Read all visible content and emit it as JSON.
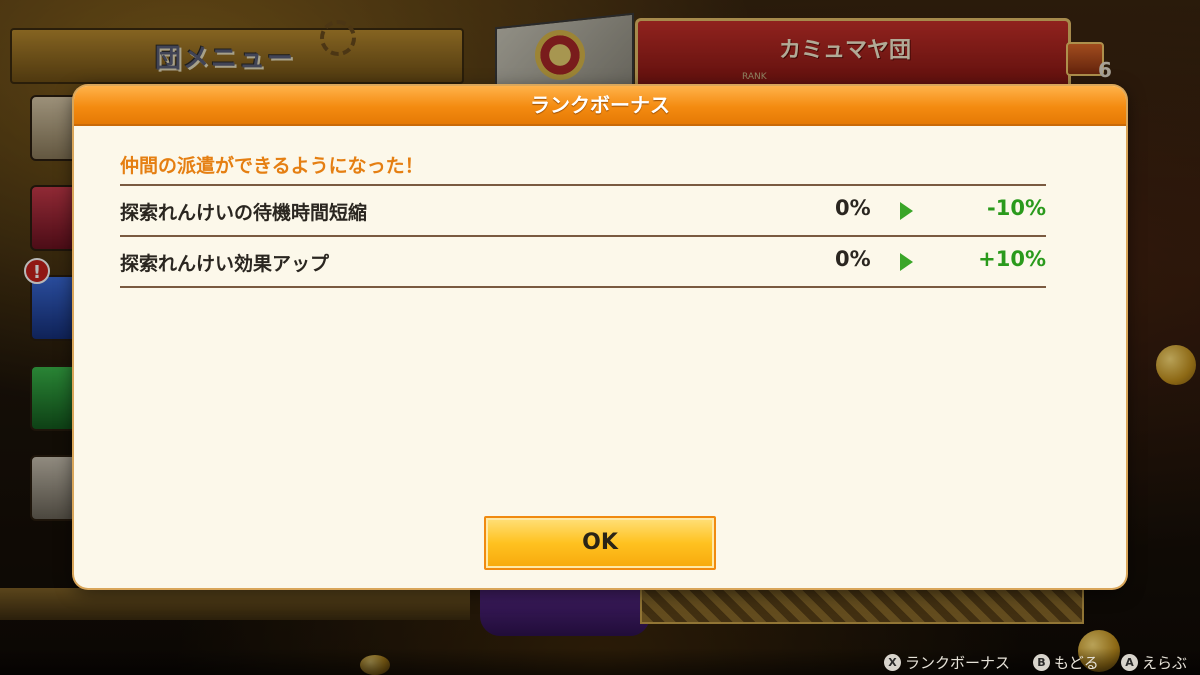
{
  "background": {
    "guild_menu_title": "団メニュー",
    "team_name": "カミュマヤ団",
    "rank_label": "RANK",
    "chest_count": "6"
  },
  "dialog": {
    "title": "ランクボーナス",
    "headline": "仲間の派遣ができるようになった！",
    "rows": [
      {
        "label": "探索れんけいの待機時間短縮",
        "before": "0%",
        "after": "-10%"
      },
      {
        "label": "探索れんけい効果アップ",
        "before": "0%",
        "after": "+10%"
      }
    ],
    "ok_label": "OK"
  },
  "hints": [
    {
      "button": "X",
      "label": "ランクボーナス"
    },
    {
      "button": "B",
      "label": "もどる"
    },
    {
      "button": "A",
      "label": "えらぶ"
    }
  ],
  "colors": {
    "header_orange": "#f48b10",
    "headline_orange": "#e57f12",
    "positive_green": "#2a9a1c",
    "panel_bg": "#fcf8ea",
    "ok_button_yellow": "#ffc220"
  }
}
